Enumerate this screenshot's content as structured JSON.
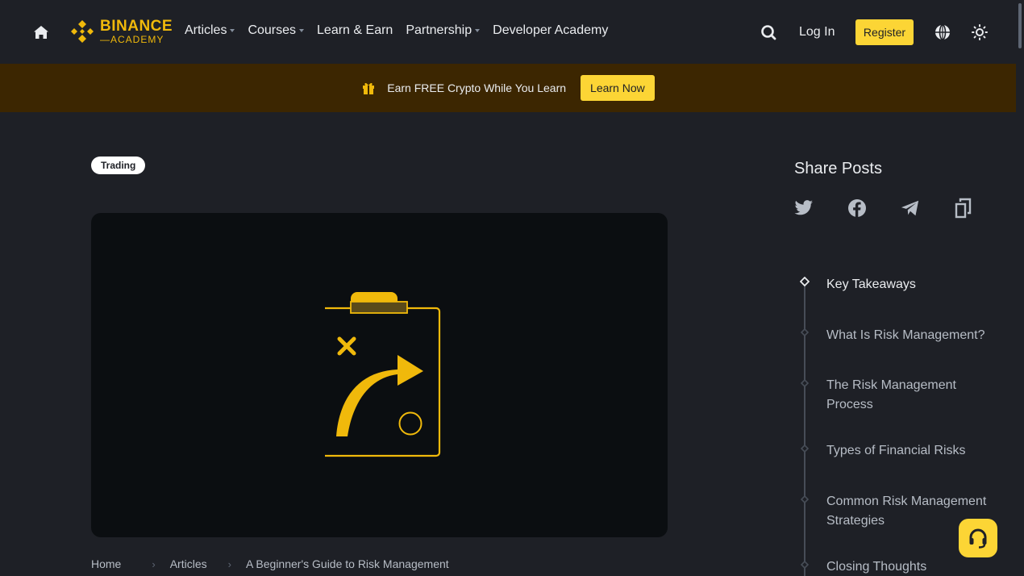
{
  "header": {
    "logo": {
      "line1": "BINANCE",
      "line2": "—ACADEMY"
    },
    "nav": [
      {
        "label": "Articles",
        "dropdown": true
      },
      {
        "label": "Courses",
        "dropdown": true
      },
      {
        "label": "Learn & Earn",
        "dropdown": false
      },
      {
        "label": "Partnership",
        "dropdown": true
      },
      {
        "label": "Developer Academy",
        "dropdown": false
      }
    ],
    "login_label": "Log In",
    "register_label": "Register"
  },
  "banner": {
    "text": "Earn FREE Crypto While You Learn",
    "button_label": "Learn Now"
  },
  "article": {
    "tag": "Trading",
    "breadcrumb": {
      "home": "Home",
      "section": "Articles",
      "current": "A Beginner's Guide to Risk Management"
    }
  },
  "sidebar": {
    "share_title": "Share Posts",
    "share_icons": [
      "twitter-icon",
      "facebook-icon",
      "telegram-icon",
      "copy-link-icon"
    ],
    "toc": [
      {
        "label": "Key Takeaways",
        "active": true
      },
      {
        "label": "What Is Risk Management?",
        "active": false
      },
      {
        "label": "The Risk Management Process",
        "active": false
      },
      {
        "label": "Types of Financial Risks",
        "active": false
      },
      {
        "label": "Common Risk Management Strategies",
        "active": false
      },
      {
        "label": "Closing Thoughts",
        "active": false
      }
    ]
  },
  "colors": {
    "accent": "#FCD535",
    "brand": "#F0B90B",
    "background": "#1E2026",
    "banner": "#3C2601"
  }
}
